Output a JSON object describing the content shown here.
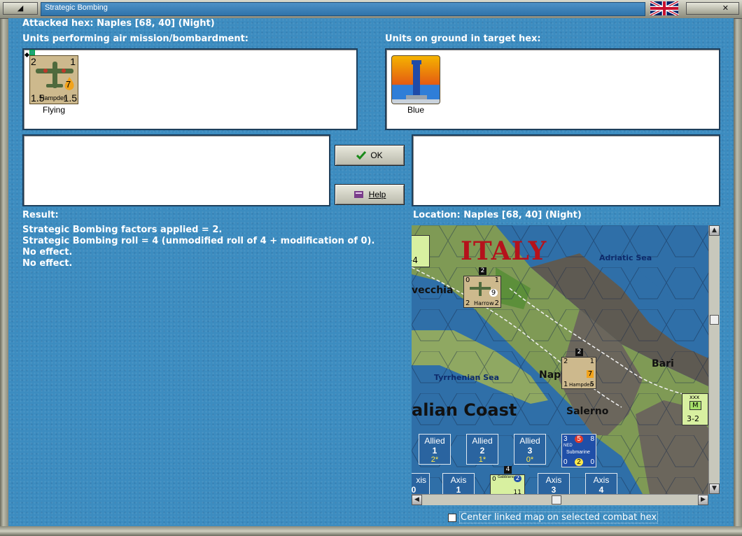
{
  "window": {
    "title": "Strategic Bombing",
    "min_glyph": "◢",
    "close_glyph": "✕",
    "flag_icon": "uk-flag-icon"
  },
  "header": {
    "attacked_hex": "Attacked hex: Naples  [68, 40] (Night)"
  },
  "air_units": {
    "label": "Units performing air mission/bombardment:",
    "units": [
      {
        "name": "Hampden",
        "status": "Flying",
        "top_left": "2",
        "top_right": "1",
        "bottom_left": "1.5",
        "bottom_right": "1.5",
        "badge": "7"
      }
    ]
  },
  "ground_units": {
    "label": "Units on ground in target hex:",
    "units": [
      {
        "status": "Blue",
        "icon": "lighthouse-icon"
      }
    ]
  },
  "buttons": {
    "ok": "OK",
    "help": "Help"
  },
  "result": {
    "label": "Result:",
    "lines": [
      "Strategic Bombing factors applied = 2.",
      "Strategic Bombing roll = 4 (unmodified roll of 4 + modification of 0).",
      "No effect.",
      "No effect."
    ]
  },
  "location": {
    "label": "Location:  Naples  [68, 40] (Night)"
  },
  "map": {
    "country_label": "ITALY",
    "coast_label": "alian Coast",
    "seas": [
      "Adriatic Sea",
      "Tyrrhenian Sea"
    ],
    "cities": [
      "vecchia",
      "Napl",
      "Bari",
      "Salerno"
    ],
    "counters": [
      {
        "name": "Harrow",
        "top_left": "0",
        "top_right": "1",
        "bottom_left": "2",
        "bottom_right": "2",
        "badge": "9",
        "stack": "2"
      },
      {
        "name": "Hampden",
        "top_left": "2",
        "top_right": "1",
        "bottom_left": "1",
        "bottom_right": "5",
        "badge": "7",
        "stack": "2"
      },
      {
        "name": "M",
        "top": "xxx",
        "bottom": "3-2"
      },
      {
        "name": "",
        "bottom": "-4"
      }
    ],
    "allied_boxes": [
      {
        "title": "Allied",
        "number": "1",
        "sub": "2*"
      },
      {
        "title": "Allied",
        "number": "2",
        "sub": "1*"
      },
      {
        "title": "Allied",
        "number": "3",
        "sub": "0*"
      }
    ],
    "sub_counter": {
      "name": "Submarine",
      "top_left": "3",
      "badge": "5",
      "top_right": "8",
      "bottom_left": "0",
      "badge2": "2",
      "bottom_right": "0",
      "tag": "NED"
    },
    "axis_boxes": [
      {
        "title": "xis",
        "number": "0"
      },
      {
        "title": "Axis",
        "number": "1"
      },
      {
        "title": "Axis",
        "number": "3"
      },
      {
        "title": "Axis",
        "number": "4"
      }
    ],
    "axis_counter": {
      "name": "Gabbiano",
      "stack": "4",
      "top_left": "0",
      "badge": "2",
      "bottom": "11"
    }
  },
  "footer": {
    "center_checkbox_label": "Center linked map on selected combat hex",
    "checked": false
  }
}
